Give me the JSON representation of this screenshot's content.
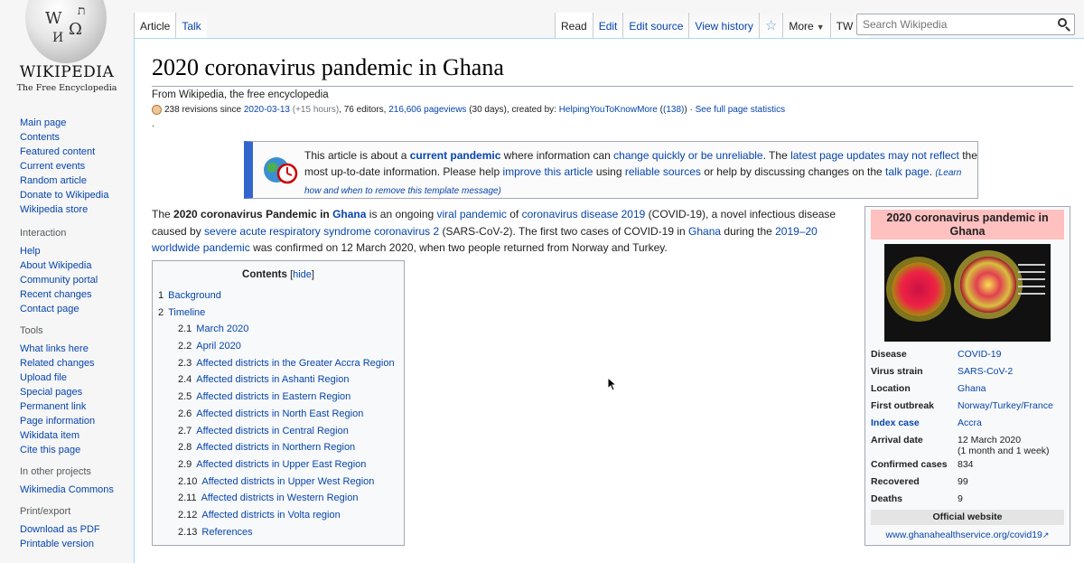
{
  "logo": {
    "wordmark": "WIKIPEDIA",
    "tagline": "The Free Encyclopedia"
  },
  "sidebar": {
    "nav": [
      "Main page",
      "Contents",
      "Featured content",
      "Current events",
      "Random article",
      "Donate to Wikipedia",
      "Wikipedia store"
    ],
    "interaction": {
      "heading": "Interaction",
      "items": [
        "Help",
        "About Wikipedia",
        "Community portal",
        "Recent changes",
        "Contact page"
      ]
    },
    "tools": {
      "heading": "Tools",
      "items": [
        "What links here",
        "Related changes",
        "Upload file",
        "Special pages",
        "Permanent link",
        "Page information",
        "Wikidata item",
        "Cite this page"
      ]
    },
    "other_projects": {
      "heading": "In other projects",
      "items": [
        "Wikimedia Commons"
      ]
    },
    "print_export": {
      "heading": "Print/export",
      "items": [
        "Download as PDF",
        "Printable version"
      ]
    }
  },
  "tabs": {
    "left": [
      "Article",
      "Talk"
    ],
    "right": {
      "read": "Read",
      "edit": "Edit",
      "edit_source": "Edit source",
      "view_history": "View history",
      "more": "More",
      "tw": "TW"
    }
  },
  "search": {
    "placeholder": "Search Wikipedia"
  },
  "article": {
    "title": "2020 coronavirus pandemic in Ghana",
    "tagline": "From Wikipedia, the free encyclopedia",
    "stats": {
      "revisions": "238 revisions since",
      "date": "2020-03-13",
      "hours": "(+15 hours)",
      "editors": ", 76 editors,",
      "pageviews": "216,606 pageviews",
      "days": "(30 days), created by:",
      "creator": "HelpingYouToKnowMore",
      "creator_count": "(138)",
      "sep": "·",
      "full_stats": "See full page statistics"
    },
    "stray_dot": "."
  },
  "ambox": {
    "t1": "This article is about a ",
    "current_pandemic": "current pandemic",
    "t2": " where information can ",
    "change_quickly": "change quickly or be unreliable",
    "t3": ". The ",
    "latest_updates": "latest page updates",
    "t4": " ",
    "may_not_reflect": "may not reflect",
    "t5": " the most up-to-date information. Please help ",
    "improve": "improve this article",
    "t6": " using ",
    "reliable_sources": "reliable sources",
    "t7": " or help by discussing changes on the ",
    "talk_page": "talk page",
    "t8": ". ",
    "learn_how": "(Learn how and when to remove this template message)"
  },
  "lead": {
    "p1": "The ",
    "b1": "2020 coronavirus Pandemic in ",
    "ghana_bold": "Ghana",
    "p2": " is an ongoing ",
    "viral_pandemic": "viral pandemic",
    "p3": " of ",
    "covid_disease": "coronavirus disease 2019",
    "p4": " (COVID-19), a novel infectious disease caused by ",
    "sars": "severe acute respiratory syndrome coronavirus 2",
    "p5": " (SARS-CoV-2). The first two cases of COVID-19 in ",
    "ghana": "Ghana",
    "p6": " during the ",
    "worldwide": "2019–20 worldwide pandemic",
    "p7": " was confirmed on 12 March 2020, when two people returned from Norway and Turkey."
  },
  "toc": {
    "title": "Contents",
    "hide": "hide",
    "items": [
      {
        "num": "1",
        "label": "Background"
      },
      {
        "num": "2",
        "label": "Timeline"
      },
      {
        "num": "2.1",
        "label": "March 2020"
      },
      {
        "num": "2.2",
        "label": "April 2020"
      },
      {
        "num": "2.3",
        "label": "Affected districts in the Greater Accra Region"
      },
      {
        "num": "2.4",
        "label": "Affected districts in Ashanti Region"
      },
      {
        "num": "2.5",
        "label": "Affected districts in Eastern Region"
      },
      {
        "num": "2.6",
        "label": "Affected districts in North East Region"
      },
      {
        "num": "2.7",
        "label": "Affected districts in Central Region"
      },
      {
        "num": "2.8",
        "label": "Affected districts in Northern Region"
      },
      {
        "num": "2.9",
        "label": "Affected districts in Upper East Region"
      },
      {
        "num": "2.10",
        "label": "Affected districts in Upper West Region"
      },
      {
        "num": "2.11",
        "label": "Affected districts in Western Region"
      },
      {
        "num": "2.12",
        "label": "Affected districts in Volta region"
      },
      {
        "num": "2.13",
        "label": "References"
      }
    ]
  },
  "infobox": {
    "title": "2020 coronavirus pandemic in Ghana",
    "rows": [
      {
        "key": "Disease",
        "value": "COVID-19",
        "key_link": false,
        "value_link": true
      },
      {
        "key": "Virus strain",
        "value": "SARS-CoV-2",
        "key_link": false,
        "value_link": true
      },
      {
        "key": "Location",
        "value": "Ghana",
        "key_link": false,
        "value_link": true
      },
      {
        "key": "First outbreak",
        "value": "Norway/Turkey/France",
        "key_link": false,
        "value_link": true
      },
      {
        "key": "Index case",
        "value": "Accra",
        "key_link": true,
        "value_link": true
      },
      {
        "key": "Arrival date",
        "value": "12 March 2020",
        "value2": "(1 month and 1 week)",
        "key_link": false,
        "value_link": false
      },
      {
        "key": "Confirmed cases",
        "value": "834",
        "key_link": false,
        "value_link": false
      },
      {
        "key": "Recovered",
        "value": "99",
        "key_link": false,
        "value_link": false
      },
      {
        "key": "Deaths",
        "value": "9",
        "key_link": false,
        "value_link": false
      }
    ],
    "official_website_label": "Official website",
    "website": "www.ghanahealthservice.org/covid19"
  },
  "colors": {
    "link": "#0645ad",
    "ambox_accent": "#3366cc",
    "infobox_title_bg": "#ffc0c0"
  }
}
